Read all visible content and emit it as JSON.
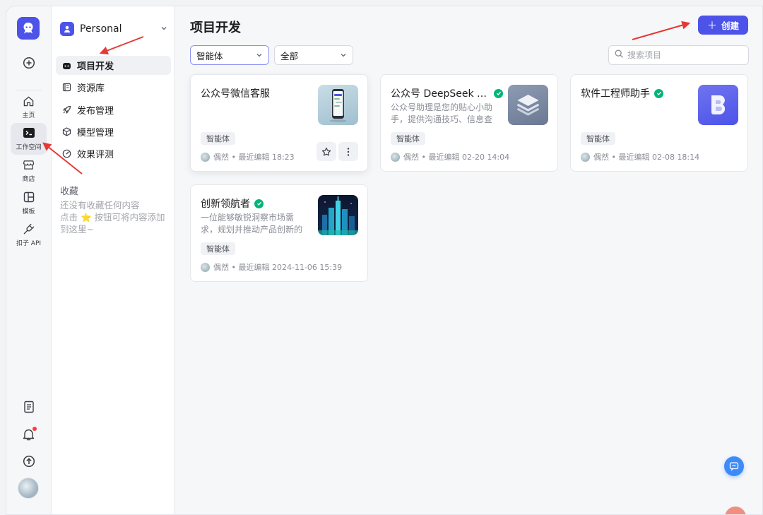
{
  "rail": {
    "items": [
      {
        "label": ""
      },
      {
        "label": "主页"
      },
      {
        "label": "工作空间"
      },
      {
        "label": "商店"
      },
      {
        "label": "模板"
      },
      {
        "label": "扣子 API"
      }
    ]
  },
  "sidebar": {
    "workspace": "Personal",
    "nav": [
      {
        "label": "项目开发"
      },
      {
        "label": "资源库"
      },
      {
        "label": "发布管理"
      },
      {
        "label": "模型管理"
      },
      {
        "label": "效果评测"
      }
    ],
    "favorites_title": "收藏",
    "favorites_empty": "还没有收藏任何内容",
    "favorites_hint": "点击 ⭐ 按钮可将内容添加到这里~"
  },
  "main": {
    "title": "项目开发",
    "create_label": "创建",
    "filter_type": "智能体",
    "filter_scope": "全部",
    "search_placeholder": "搜索项目"
  },
  "cards": [
    {
      "title": "公众号微信客服",
      "desc": "",
      "tag": "智能体",
      "meta": "偶然 • 最近编辑 18:23"
    },
    {
      "title": "公众号 DeepSeek 助手",
      "desc": "公众号助理是您的贴心小助手，提供沟通技巧、信息查询等服务",
      "tag": "智能体",
      "meta": "偶然 • 最近编辑 02-20 14:04"
    },
    {
      "title": "软件工程师助手",
      "desc": "",
      "tag": "智能体",
      "meta": "偶然 • 最近编辑 02-08 18:14"
    },
    {
      "title": "创新领航者",
      "desc": "一位能够敏锐洞察市场需求，规划并推动产品创新的专家",
      "tag": "智能体",
      "meta": "偶然 • 最近编辑 2024-11-06 15:39"
    }
  ],
  "colors": {
    "accent": "#4d53e8",
    "verified": "#00b578",
    "annotation_arrow": "#e53935"
  }
}
